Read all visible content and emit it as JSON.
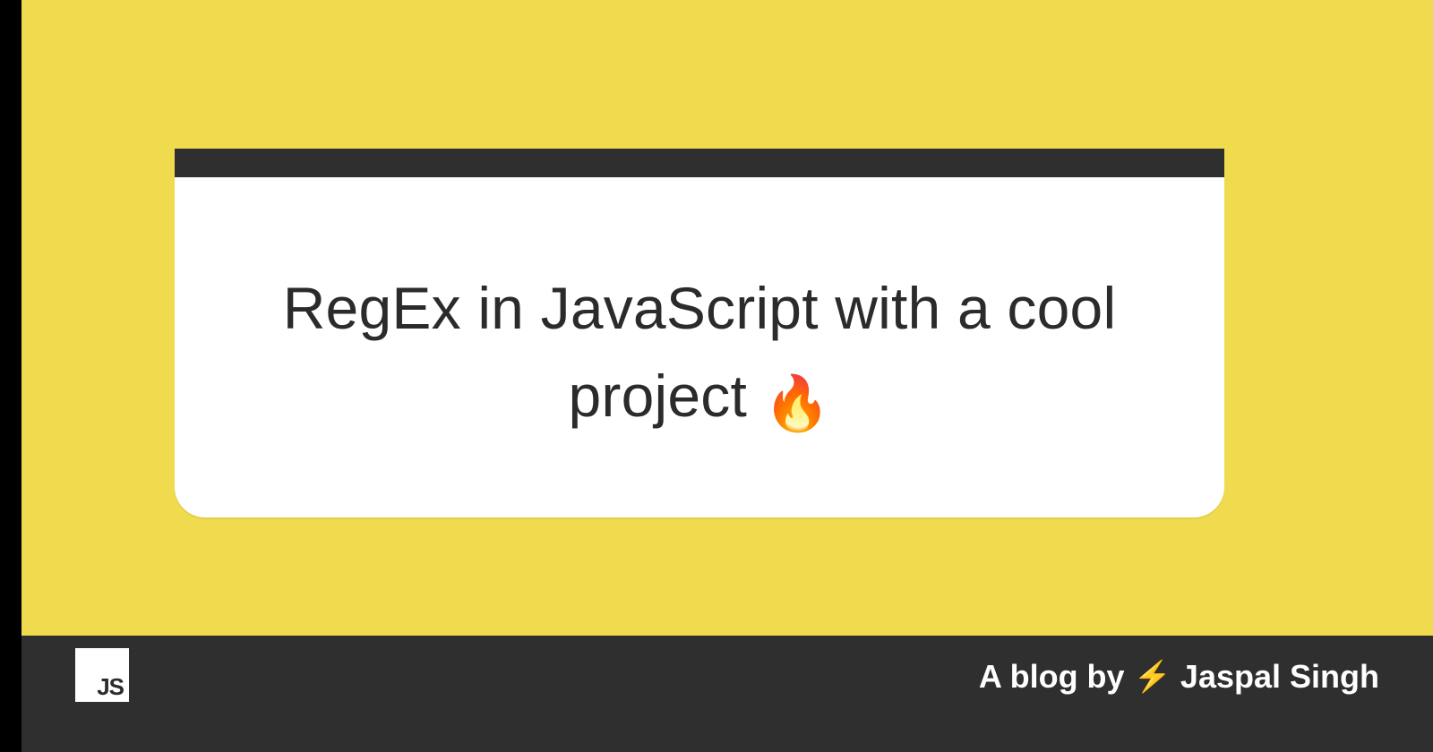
{
  "title": "RegEx in JavaScript with a cool project ",
  "title_emoji": "🔥",
  "footer": {
    "byline_prefix": "A blog by ",
    "bolt_emoji": "⚡",
    "author": " Jaspal Singh",
    "logo_text": "JS"
  }
}
